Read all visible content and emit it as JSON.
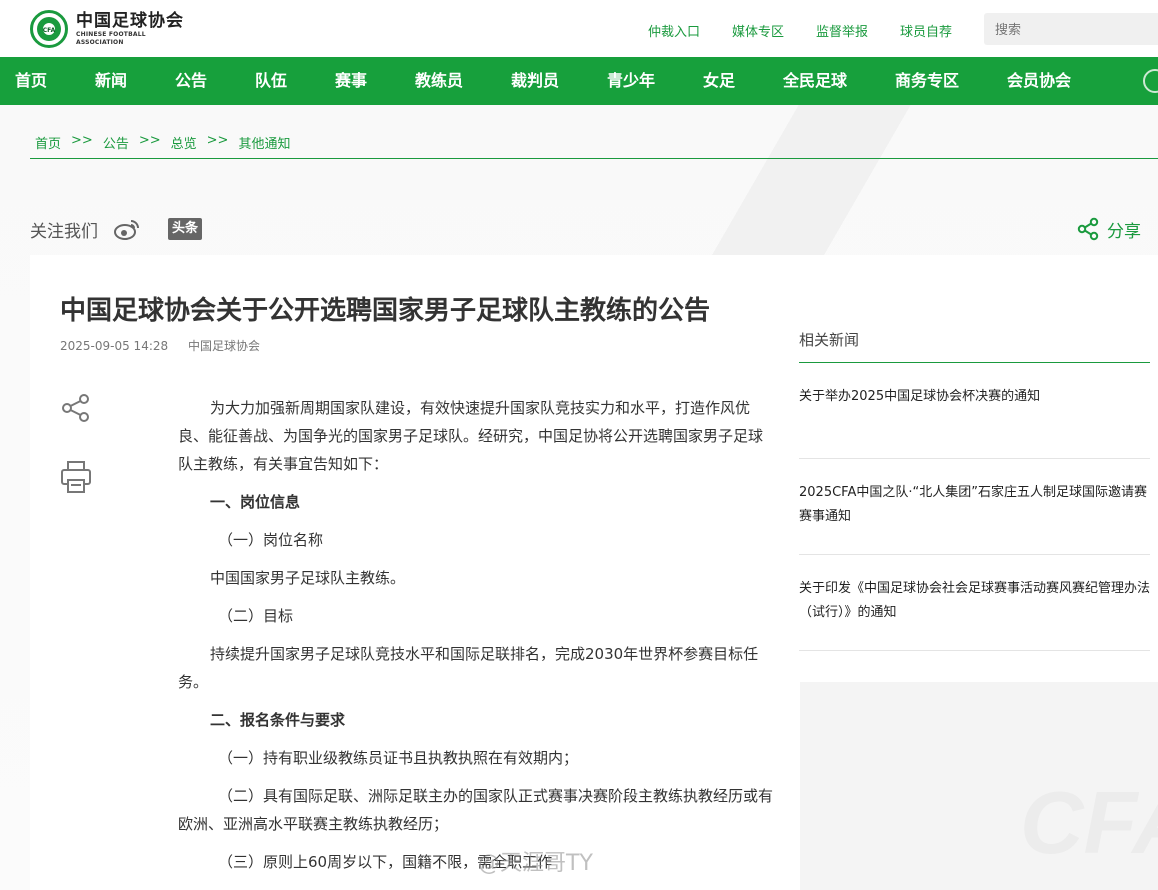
{
  "header": {
    "logo_cn": "中国足球协会",
    "logo_en": "CHINESE FOOTBALL ASSOCIATION",
    "logo_badge": "CFA",
    "top_links": [
      "仲裁入口",
      "媒体专区",
      "监督举报",
      "球员自荐"
    ],
    "search_placeholder": "搜索"
  },
  "nav": {
    "items": [
      "首页",
      "新闻",
      "公告",
      "队伍",
      "赛事",
      "教练员",
      "裁判员",
      "青少年",
      "女足",
      "全民足球",
      "商务专区",
      "会员协会"
    ]
  },
  "breadcrumb": {
    "items": [
      "首页",
      "公告",
      "总览",
      "其他通知"
    ],
    "separator": ">>"
  },
  "follow": {
    "label": "关注我们",
    "toutiao": "头条",
    "share_label": "分享"
  },
  "article": {
    "title": "中国足球协会关于公开选聘国家男子足球队主教练的公告",
    "date": "2025-09-05 14:28",
    "source": "中国足球协会",
    "p1": "为大力加强新周期国家队建设，有效快速提升国家队竞技实力和水平，打造作风优良、能征善战、为国争光的国家男子足球队。经研究，中国足协将公开选聘国家男子足球队主教练，有关事宜告知如下：",
    "h1": "一、岗位信息",
    "s1": "（一）岗位名称",
    "p2": "中国国家男子足球队主教练。",
    "s2": "（二）目标",
    "p3": "持续提升国家男子足球队竞技水平和国际足联排名，完成2030年世界杯参赛目标任务。",
    "h2": "二、报名条件与要求",
    "r1": "（一）持有职业级教练员证书且执教执照在有效期内；",
    "r2": "（二）具有国际足联、洲际足联主办的国家队正式赛事决赛阶段主教练执教经历或有欧洲、亚洲高水平联赛主教练执教经历；",
    "r3": "（三）原则上60周岁以下，国籍不限，需全职工作"
  },
  "related": {
    "title": "相关新闻",
    "items": [
      "关于举办2025中国足球协会杯决赛的通知",
      "2025CFA中国之队·“北人集团”石家庄五人制足球国际邀请赛赛事通知",
      "关于印发《中国足球协会社会足球赛事活动赛风赛纪管理办法（试行）》的通知"
    ],
    "deco_text": "CFA"
  },
  "watermark": "@天涯哥TY",
  "colors": {
    "brand_green": "#17a03c",
    "link_green": "#1a9a3e"
  }
}
